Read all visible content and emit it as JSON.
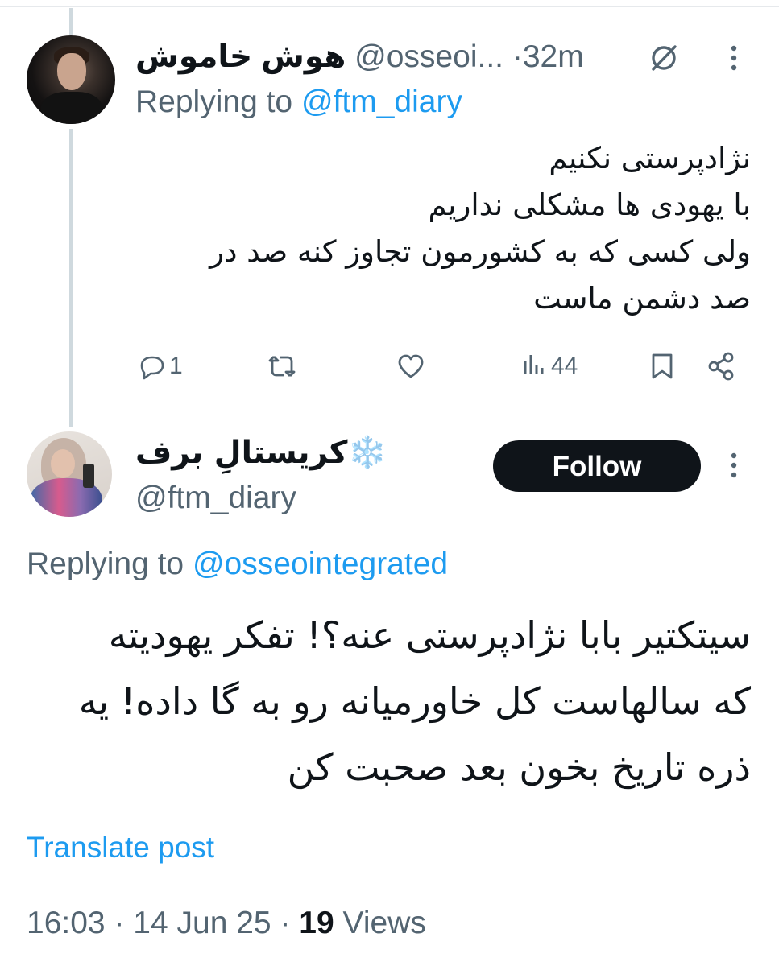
{
  "colors": {
    "text": "#0f1419",
    "muted": "#536471",
    "accent": "#1d9bf0",
    "thread": "#cfd9de"
  },
  "reply_tweet": {
    "name": "هوش خاموش",
    "handle": "@osseoi...",
    "separator": "·",
    "time": "32m",
    "replying_label": "Replying to",
    "replying_to": "@ftm_diary",
    "body_lines": [
      "نژادپرستی نکنیم",
      "با یهودی ها مشکلی نداریم",
      "ولی کسی که به کشورمون تجاوز کنه صد در",
      "صد دشمن ماست"
    ],
    "actions": {
      "replies": "1",
      "reposts": "",
      "likes": "",
      "views": "44"
    },
    "icons": [
      "grok-icon",
      "more-icon",
      "reply-icon",
      "repost-icon",
      "like-icon",
      "views-icon",
      "bookmark-icon",
      "share-icon"
    ]
  },
  "main_tweet": {
    "name": "کریستالِ برف",
    "emoji": "❄️",
    "handle": "@ftm_diary",
    "follow_label": "Follow",
    "replying_label": "Replying to",
    "replying_to": "@osseointegrated",
    "body_lines": [
      "سیتکتیر بابا نژادپرستی عنه؟! تفکر یهودیته",
      "که سالهاست کل خاورمیانه رو به گا داده! یه",
      "ذره تاریخ بخون بعد صحبت کن"
    ],
    "translate_label": "Translate post",
    "time": "16:03",
    "date": "14 Jun 25",
    "separator": "·",
    "views_count": "19",
    "views_label": "Views"
  }
}
